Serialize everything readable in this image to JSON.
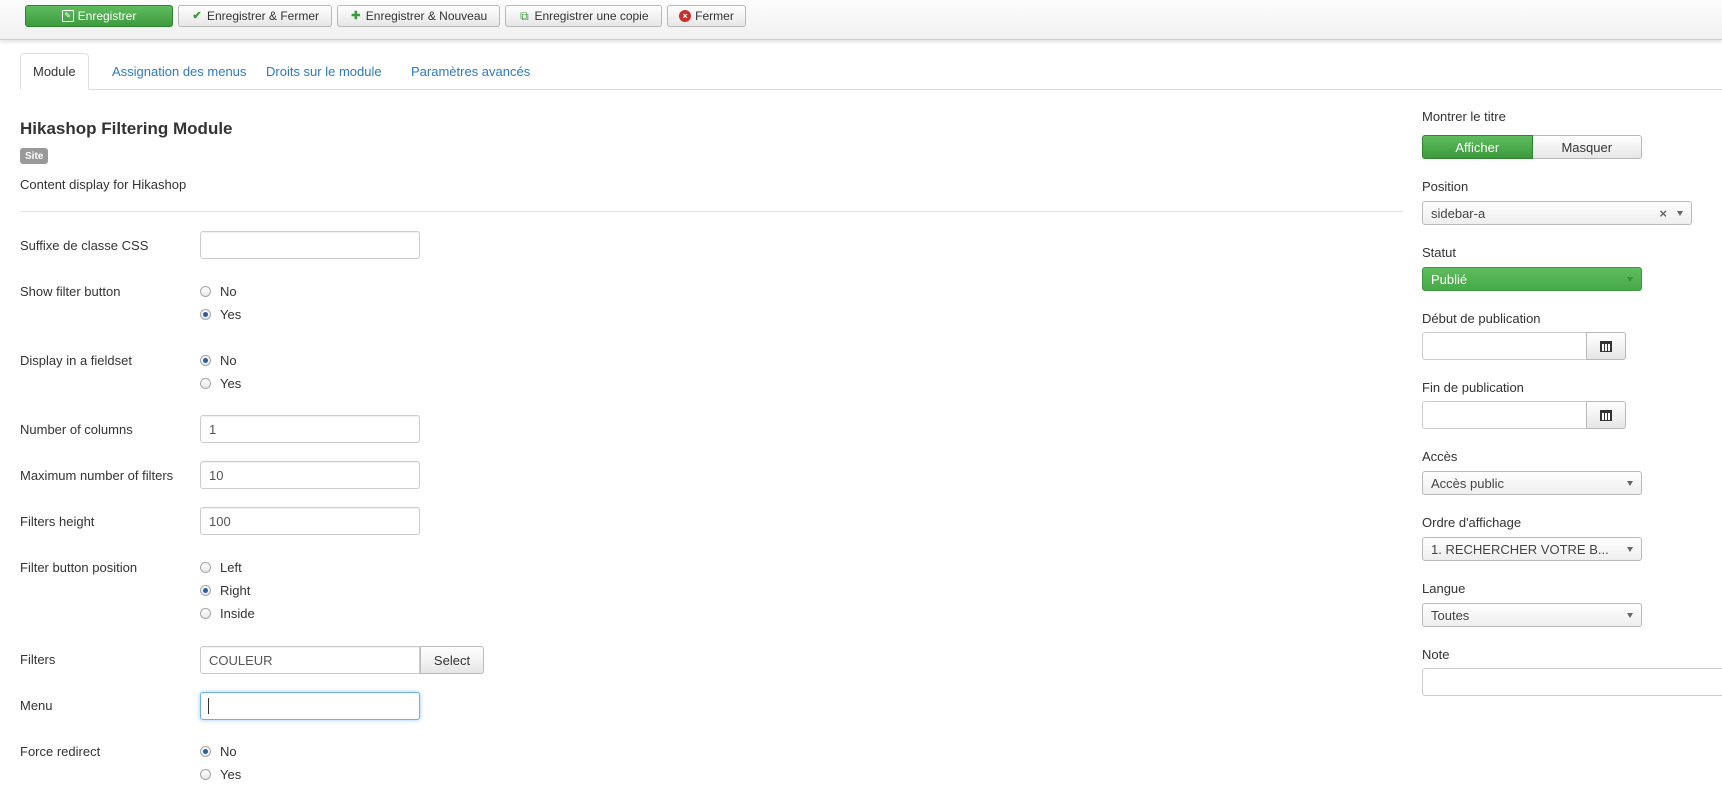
{
  "toolbar": {
    "save": "Enregistrer",
    "save_close": "Enregistrer & Fermer",
    "save_new": "Enregistrer & Nouveau",
    "save_copy": "Enregistrer une copie",
    "close": "Fermer"
  },
  "tabs": [
    "Module",
    "Assignation des menus",
    "Droits sur le module",
    "Paramètres avancés"
  ],
  "module": {
    "title": "Hikashop Filtering Module",
    "badge": "Site",
    "description": "Content display for Hikashop"
  },
  "form": {
    "css_suffix": {
      "label": "Suffixe de classe CSS",
      "value": ""
    },
    "show_filter_button": {
      "label": "Show filter button",
      "options": [
        "No",
        "Yes"
      ],
      "selected": "Yes"
    },
    "display_fieldset": {
      "label": "Display in a fieldset",
      "options": [
        "No",
        "Yes"
      ],
      "selected": "No"
    },
    "num_columns": {
      "label": "Number of columns",
      "value": "1"
    },
    "max_filters": {
      "label": "Maximum number of filters",
      "value": "10"
    },
    "filters_height": {
      "label": "Filters height",
      "value": "100"
    },
    "filter_button_position": {
      "label": "Filter button position",
      "options": [
        "Left",
        "Right",
        "Inside"
      ],
      "selected": "Right"
    },
    "filters": {
      "label": "Filters",
      "value": "COULEUR",
      "button": "Select"
    },
    "menu": {
      "label": "Menu",
      "value": ""
    },
    "force_redirect": {
      "label": "Force redirect",
      "options": [
        "No",
        "Yes"
      ],
      "selected": "No"
    }
  },
  "sidebar": {
    "show_title": {
      "label": "Montrer le titre",
      "on": "Afficher",
      "off": "Masquer"
    },
    "position": {
      "label": "Position",
      "value": "sidebar-a"
    },
    "status": {
      "label": "Statut",
      "value": "Publié"
    },
    "publish_up": {
      "label": "Début de publication",
      "value": ""
    },
    "publish_down": {
      "label": "Fin de publication",
      "value": ""
    },
    "access": {
      "label": "Accès",
      "value": "Accès public"
    },
    "ordering": {
      "label": "Ordre d'affichage",
      "value": "1. RECHERCHER VOTRE B..."
    },
    "language": {
      "label": "Langue",
      "value": "Toutes"
    },
    "note": {
      "label": "Note",
      "value": ""
    }
  },
  "colors": {
    "accent_green": "#46a546",
    "link_blue": "#2d7ac2",
    "danger_red": "#c9302c"
  }
}
